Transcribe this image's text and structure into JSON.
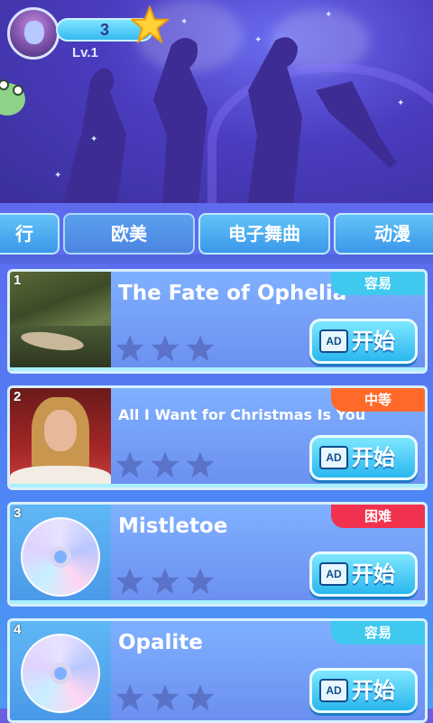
{
  "player": {
    "score": "3",
    "level": "Lv.1"
  },
  "tabs": [
    {
      "label": "行"
    },
    {
      "label": "欧美"
    },
    {
      "label": "电子舞曲"
    },
    {
      "label": "动漫"
    }
  ],
  "songs": [
    {
      "rank": "1",
      "title": "The Fate of Ophelia",
      "difficulty": "容易",
      "stars_filled": 0,
      "stars_total": 3,
      "button_icon": "AD",
      "button_label": "开始",
      "cover": "painting"
    },
    {
      "rank": "2",
      "title": "All I Want for Christmas Is You",
      "difficulty": "中等",
      "stars_filled": 0,
      "stars_total": 3,
      "button_icon": "AD",
      "button_label": "开始",
      "cover": "portrait"
    },
    {
      "rank": "3",
      "title": "Mistletoe",
      "difficulty": "困难",
      "stars_filled": 0,
      "stars_total": 3,
      "button_icon": "AD",
      "button_label": "开始",
      "cover": "cd-disc"
    },
    {
      "rank": "4",
      "title": "Opalite",
      "difficulty": "容易",
      "stars_filled": 0,
      "stars_total": 3,
      "button_icon": "AD",
      "button_label": "开始",
      "cover": "cd-disc"
    }
  ],
  "colors": {
    "easy": "#3fc9ee",
    "medium": "#ff6a2a",
    "hard": "#f0324f",
    "accent": "#29b7ee"
  }
}
